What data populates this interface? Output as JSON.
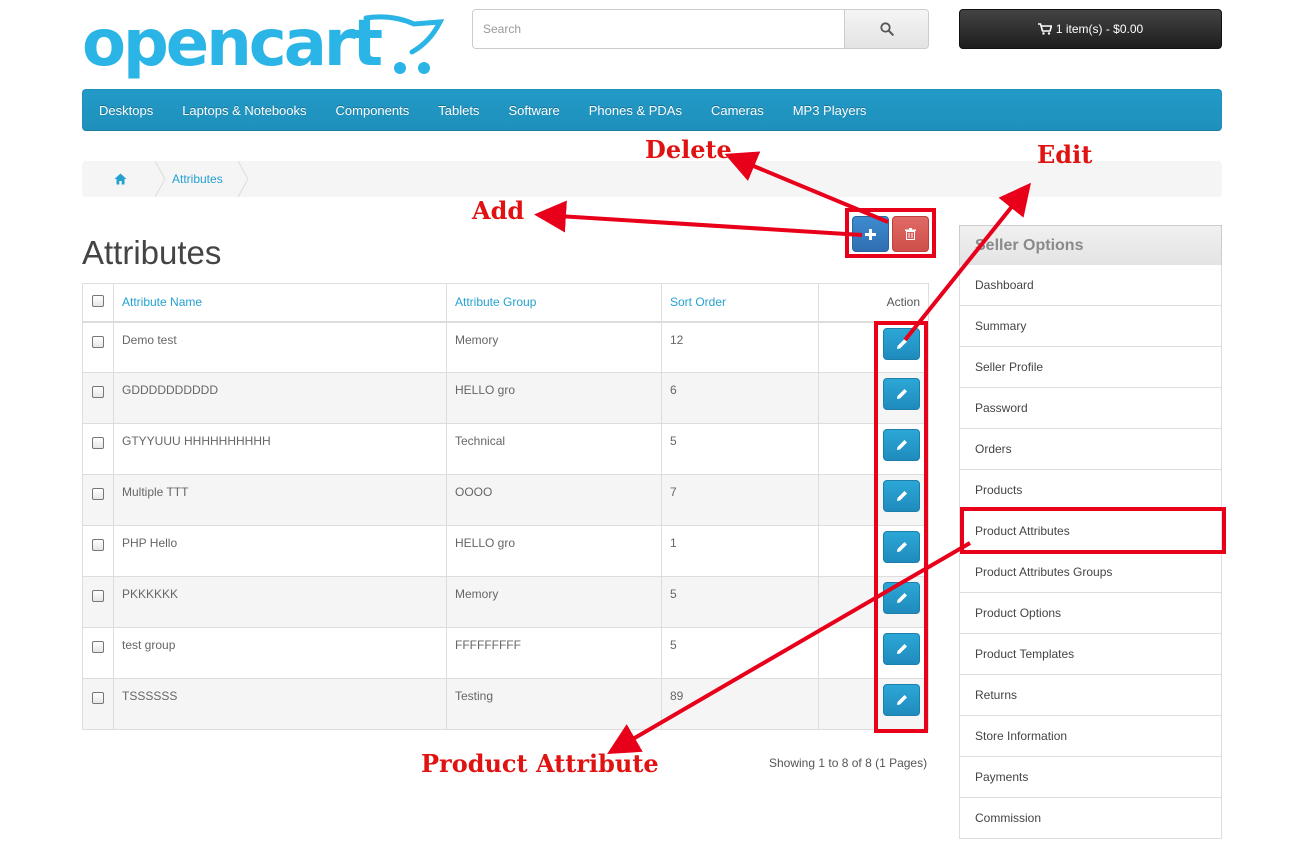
{
  "header": {
    "logo_text": "opencart",
    "search_placeholder": "Search",
    "cart_label": "1 item(s) - $0.00"
  },
  "menu": [
    "Desktops",
    "Laptops & Notebooks",
    "Components",
    "Tablets",
    "Software",
    "Phones & PDAs",
    "Cameras",
    "MP3 Players"
  ],
  "breadcrumb": {
    "current": "Attributes"
  },
  "page_title": "Attributes",
  "table": {
    "headers": {
      "name": "Attribute Name",
      "group": "Attribute Group",
      "sort": "Sort Order",
      "action": "Action"
    },
    "rows": [
      {
        "name": "Demo test",
        "group": "Memory",
        "sort": "12"
      },
      {
        "name": "GDDDDDDDDDD",
        "group": "HELLO gro",
        "sort": "6"
      },
      {
        "name": "GTYYUUU HHHHHHHHHH",
        "group": "Technical",
        "sort": "5"
      },
      {
        "name": "Multiple TTT",
        "group": "OOOO",
        "sort": "7"
      },
      {
        "name": "PHP Hello",
        "group": "HELLO gro",
        "sort": "1"
      },
      {
        "name": "PKKKKKK",
        "group": "Memory",
        "sort": "5"
      },
      {
        "name": "test group",
        "group": "FFFFFFFFF",
        "sort": "5"
      },
      {
        "name": "TSSSSSS",
        "group": "Testing",
        "sort": "89"
      }
    ]
  },
  "pagination_info": "Showing 1 to 8 of 8 (1 Pages)",
  "sidebar": {
    "title": "Seller Options",
    "items": [
      "Dashboard",
      "Summary",
      "Seller Profile",
      "Password",
      "Orders",
      "Products",
      "Product Attributes",
      "Product Attributes Groups",
      "Product Options",
      "Product Templates",
      "Returns",
      "Store Information",
      "Payments",
      "Commission"
    ]
  },
  "annotations": {
    "delete": "Delete",
    "edit": "Edit",
    "add": "Add",
    "product_attribute": "Product Attribute",
    "color": "#e8001a"
  },
  "colors": {
    "brand": "#2ab5e6",
    "menu": "#229ac8",
    "link": "#23a1d1",
    "add_button": "#3579c2",
    "delete_button": "#d9534f"
  }
}
